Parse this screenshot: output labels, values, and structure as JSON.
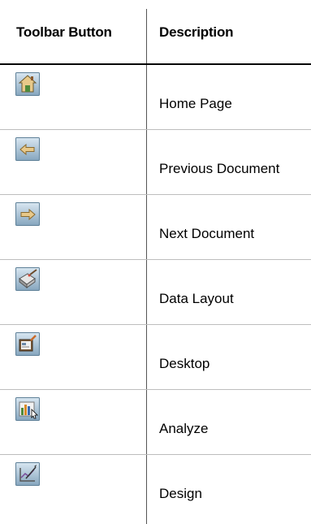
{
  "table": {
    "headers": {
      "button": "Toolbar Button",
      "description": "Description"
    },
    "rows": [
      {
        "icon": "home-icon",
        "description": "Home Page"
      },
      {
        "icon": "arrow-left-icon",
        "description": "Previous Document"
      },
      {
        "icon": "arrow-right-icon",
        "description": "Next Document"
      },
      {
        "icon": "data-layout-icon",
        "description": "Data Layout"
      },
      {
        "icon": "desktop-icon",
        "description": "Desktop"
      },
      {
        "icon": "analyze-icon",
        "description": "Analyze"
      },
      {
        "icon": "design-icon",
        "description": "Design"
      }
    ]
  },
  "colors": {
    "button_light": "#c9dceb",
    "button_dark": "#7e9fb8",
    "icon_tan": "#e8c98a",
    "icon_green": "#4f8a3a"
  }
}
